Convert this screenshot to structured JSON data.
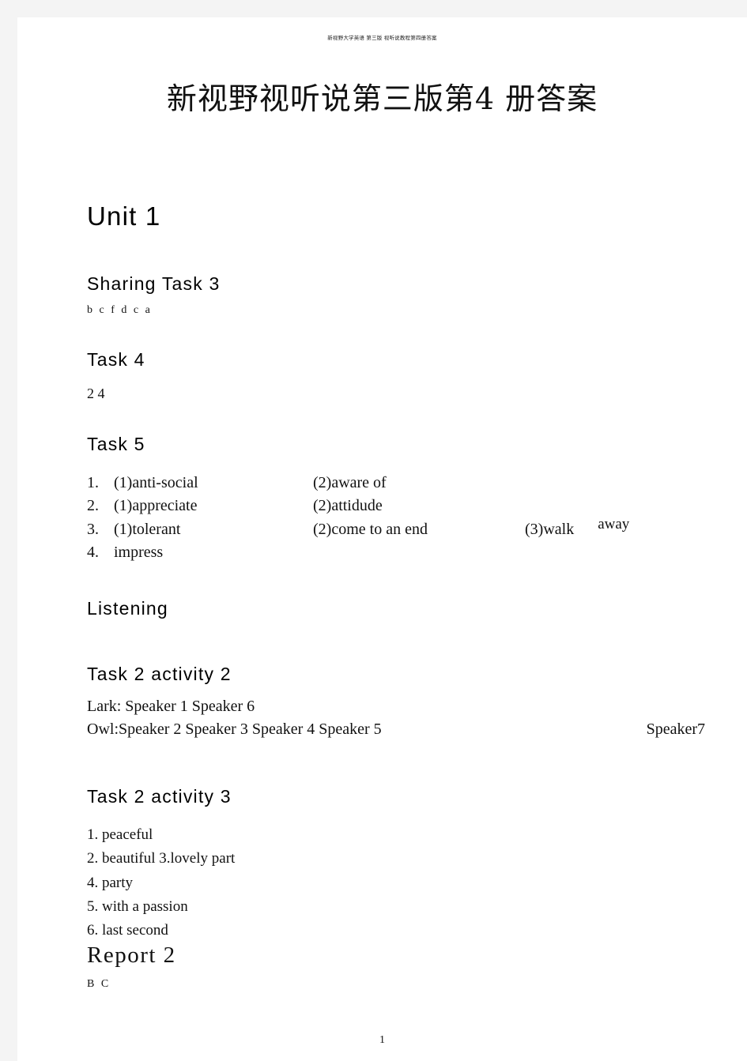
{
  "document": {
    "running_head": "新视野大学英语 第三版 视听说教程第四册答案",
    "title": "新视野视听说第三版第4 册答案",
    "page_number": "1"
  },
  "unit": {
    "heading": "Unit 1"
  },
  "sections": {
    "sharing_task_3": {
      "heading": "Sharing Task 3",
      "answer": "b c f d c a"
    },
    "task_4": {
      "heading": "Task 4",
      "answer": "2 4"
    },
    "task_5": {
      "heading": "Task 5",
      "rows": [
        {
          "num": "1.",
          "a": "(1)anti-social",
          "b": "(2)aware of",
          "c": ""
        },
        {
          "num": "2.",
          "a": "(1)appreciate",
          "b": "(2)attidude",
          "c": ""
        },
        {
          "num": "3.",
          "a": "(1)tolerant",
          "b": "(2)come to an end",
          "c": "(3)walk",
          "c_raised": "away"
        },
        {
          "num": "4.",
          "a": "impress",
          "b": "",
          "c": ""
        }
      ]
    },
    "listening": {
      "heading": "Listening"
    },
    "task_2_activity_2": {
      "heading": "Task 2 activity 2",
      "lark_line": "Lark: Speaker 1 Speaker 6",
      "owl_line": "Owl:Speaker 2 Speaker 3 Speaker 4 Speaker 5",
      "owl_line_right": "Speaker7"
    },
    "task_2_activity_3": {
      "heading": "Task 2 activity 3",
      "lines": [
        "1. peaceful",
        "2. beautiful 3.lovely part",
        "4. party",
        "5. with a passion",
        "6. last second"
      ]
    },
    "report_2": {
      "heading": "Report 2",
      "answer": "B C"
    }
  }
}
